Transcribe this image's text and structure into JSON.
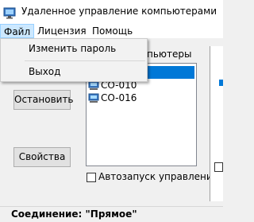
{
  "window": {
    "title": "Удаленное управление компьютерами"
  },
  "menubar": {
    "file": "Файл",
    "license": "Лицензия",
    "help": "Помощь"
  },
  "file_menu": {
    "change_password": "Изменить пароль",
    "exit": "Выход"
  },
  "main": {
    "group_label": "пьютеры",
    "computers": [
      "",
      "CO-010",
      "CO-016"
    ],
    "stop_button": "Остановить",
    "properties_button": "Свойства",
    "autorun_label": "Автозапуск управления"
  },
  "status": {
    "text": "Соединение: \"Прямое\""
  },
  "colors": {
    "selection": "#0078d7",
    "menu_highlight": "#cce8ff"
  },
  "icons": {
    "app": "monitor-icon",
    "computer": "computer-icon"
  }
}
